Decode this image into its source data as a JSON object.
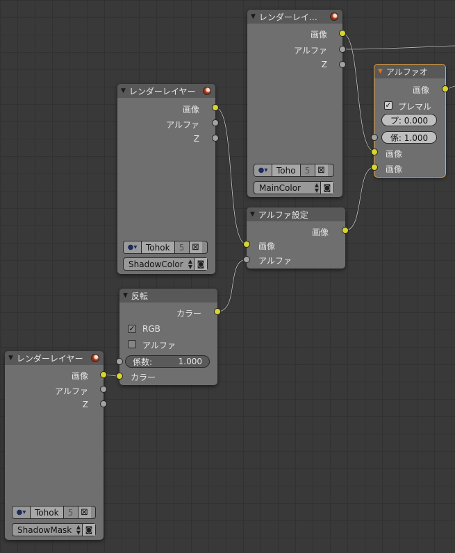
{
  "nodes": {
    "rl_main": {
      "title": "レンダーレイ…",
      "outputs": [
        "画像",
        "アルファ",
        "Z"
      ],
      "scene": "Toho",
      "layer_number": "5",
      "layer": "MainColor"
    },
    "rl_shadowcolor": {
      "title": "レンダーレイヤー",
      "outputs": [
        "画像",
        "アルファ",
        "Z"
      ],
      "scene": "Tohok",
      "layer_number": "5",
      "layer": "ShadowColor"
    },
    "rl_shadowmask": {
      "title": "レンダーレイヤー",
      "outputs": [
        "画像",
        "アルファ",
        "Z"
      ],
      "scene": "Tohok",
      "layer_number": "5",
      "layer": "ShadowMask"
    },
    "alpha_over": {
      "title": "アルファオ",
      "output": "画像",
      "premul_label": "プレマル",
      "premul_checked": true,
      "field_p": "プ: 0.000",
      "field_factor": "係: 1.000",
      "input_image1": "画像",
      "input_image2": "画像"
    },
    "set_alpha": {
      "title": "アルファ設定",
      "output": "画像",
      "input_image": "画像",
      "input_alpha": "アルファ"
    },
    "invert": {
      "title": "反転",
      "output": "カラー",
      "rgb_label": "RGB",
      "rgb_checked": true,
      "alpha_label": "アルファ",
      "alpha_checked": false,
      "factor_label": "係数:",
      "factor_value": "1.000",
      "input_color": "カラー"
    }
  },
  "colors": {
    "socket_color": "#d6d62e",
    "socket_value": "#a3a3a3",
    "active_outline": "#f0a030",
    "wire": "#1e1e1e"
  },
  "icons": [
    "render-layer-icon",
    "scene-icon",
    "close-icon",
    "camera-icon",
    "collapse-triangle-icon",
    "checkbox-check-icon"
  ]
}
